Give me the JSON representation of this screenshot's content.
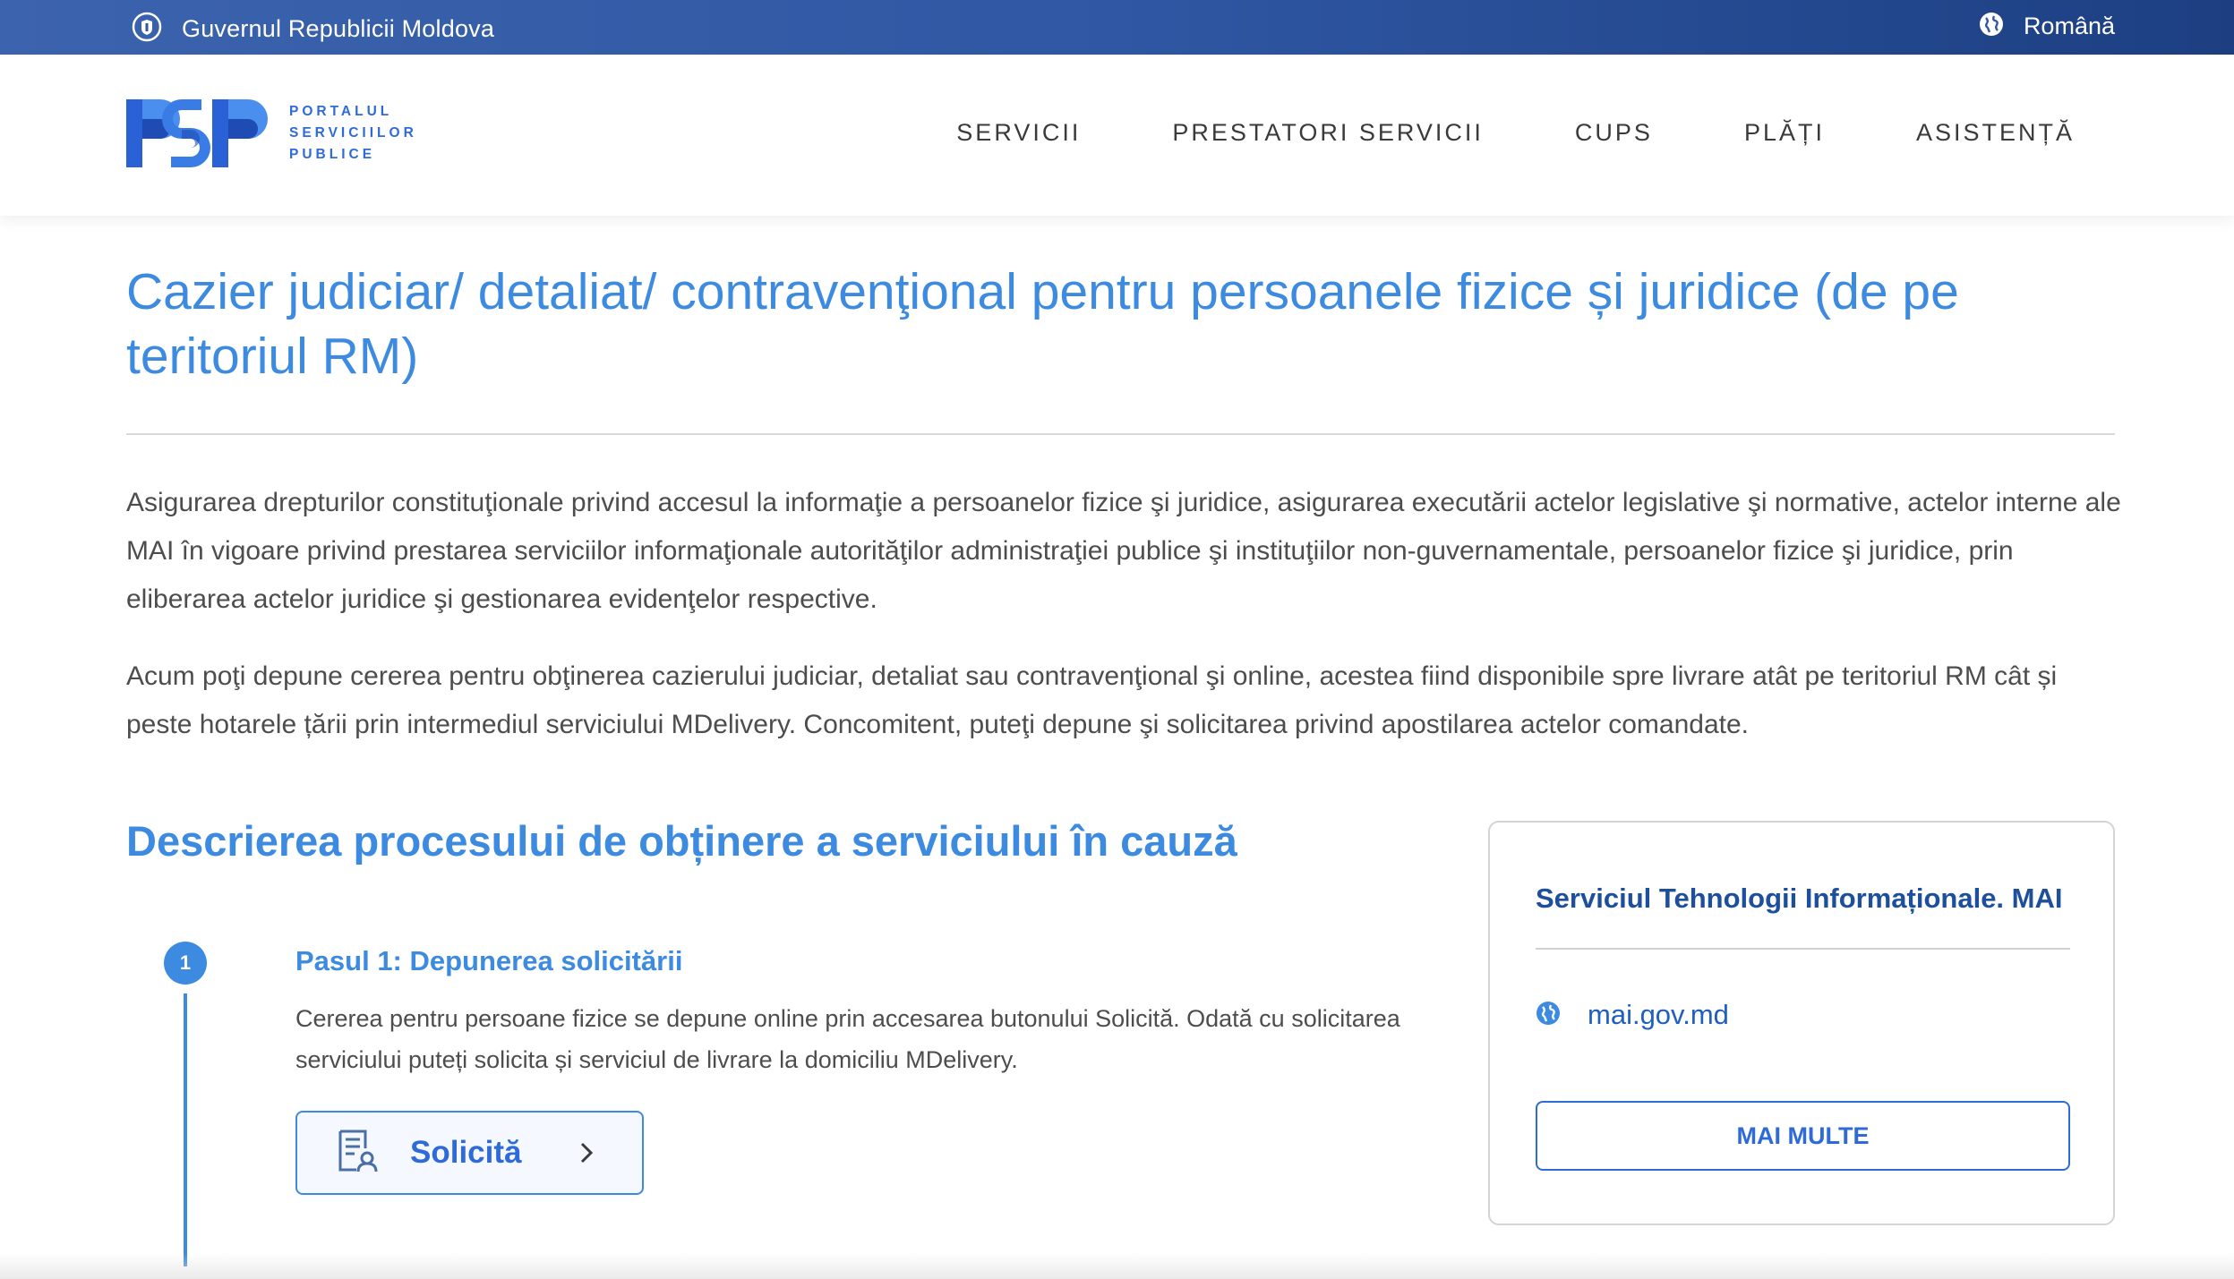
{
  "topbar": {
    "gov_label": "Guvernul Republicii Moldova",
    "gov_icon": "coat-of-arms-icon",
    "language_label": "Română",
    "language_icon": "globe-icon",
    "background_color": "#2f57a3"
  },
  "header": {
    "logo_letters": "PSP",
    "logo_line1": "PORTALUL",
    "logo_line2": "SERVICIILOR",
    "logo_line3": "PUBLICE",
    "nav": [
      {
        "label": "SERVICII"
      },
      {
        "label": "PRESTATORI SERVICII"
      },
      {
        "label": "CUPS"
      },
      {
        "label": "PLĂȚI"
      },
      {
        "label": "ASISTENȚĂ"
      }
    ]
  },
  "main": {
    "title": "Cazier judiciar/ detaliat/ contravenţional pentru persoanele fizice și juridice (de pe teritoriul RM)",
    "paragraph1": "Asigurarea drepturilor constituţionale privind accesul la informaţie a persoanelor fizice şi juridice, asigurarea executării actelor legislative şi normative, actelor interne ale MAI în vigoare privind prestarea serviciilor informaţionale autorităţilor administraţiei publice şi instituţiilor non-guvernamentale, persoanelor fizice şi juridice, prin eliberarea actelor juridice şi gestionarea evidenţelor respective.",
    "paragraph2": "Acum poţi depune cererea pentru obţinerea cazierului judiciar, detaliat sau contravenţional şi online, acestea fiind disponibile spre livrare atât pe teritoriul RM cât și peste hotarele țării prin intermediul serviciului MDelivery. Concomitent, puteţi depune şi solicitarea privind apostilarea actelor comandate.",
    "process_title": "Descrierea procesului de obținere a serviciului în cauză",
    "steps": [
      {
        "number": "1",
        "title": "Pasul 1: Depunerea solicitării",
        "description": "Cererea pentru persoane fizice se depune online prin accesarea butonului Solicită. Odată cu solicitarea serviciului puteți solicita și serviciul de livrare la domiciliu MDelivery.",
        "button_label": "Solicită",
        "button_icon": "document-user-icon"
      }
    ]
  },
  "card": {
    "title": "Serviciul Tehnologii Informaționale. MAI",
    "link_text": "mai.gov.md",
    "link_icon": "globe-icon",
    "button_label": "MAI MULTE"
  },
  "colors": {
    "accent": "#3d8be0",
    "brand_dark": "#1e4f9c",
    "text": "#4d4d4d"
  }
}
